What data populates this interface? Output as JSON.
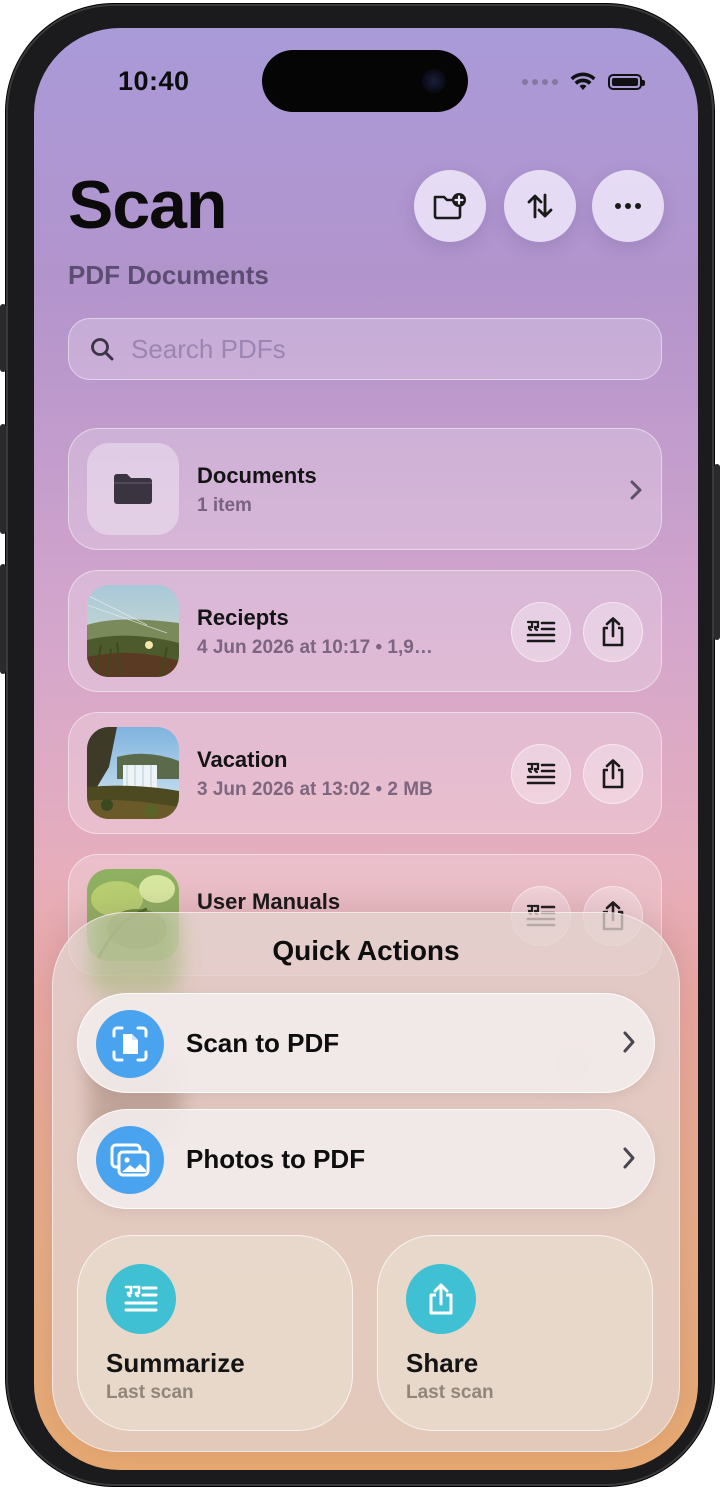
{
  "status_bar": {
    "time": "10:40"
  },
  "header": {
    "title": "Scan",
    "subtitle": "PDF Documents",
    "actions": [
      {
        "icon": "new-folder-icon"
      },
      {
        "icon": "sort-arrows-icon"
      },
      {
        "icon": "more-icon"
      }
    ]
  },
  "search": {
    "placeholder": "Search PDFs"
  },
  "items": [
    {
      "name": "Documents",
      "meta": "1 item",
      "type": "folder"
    },
    {
      "name": "Reciepts",
      "meta": "4 Jun 2026 at 10:17 • 1,9…",
      "type": "pdf"
    },
    {
      "name": "Vacation",
      "meta": "3 Jun 2026 at 13:02 • 2 MB",
      "type": "pdf"
    },
    {
      "name": "User Manuals",
      "meta": "",
      "type": "pdf"
    }
  ],
  "quick_actions": {
    "title": "Quick Actions",
    "rows": [
      {
        "label": "Scan to PDF",
        "icon": "scan-document-icon"
      },
      {
        "label": "Photos to PDF",
        "icon": "photos-icon"
      }
    ],
    "tiles": [
      {
        "label": "Summarize",
        "sub": "Last scan",
        "icon": "summarize-icon"
      },
      {
        "label": "Share",
        "sub": "Last scan",
        "icon": "share-icon"
      }
    ]
  },
  "colors": {
    "accent_blue": "#4aa3ee",
    "accent_teal": "#3fc0d3"
  }
}
